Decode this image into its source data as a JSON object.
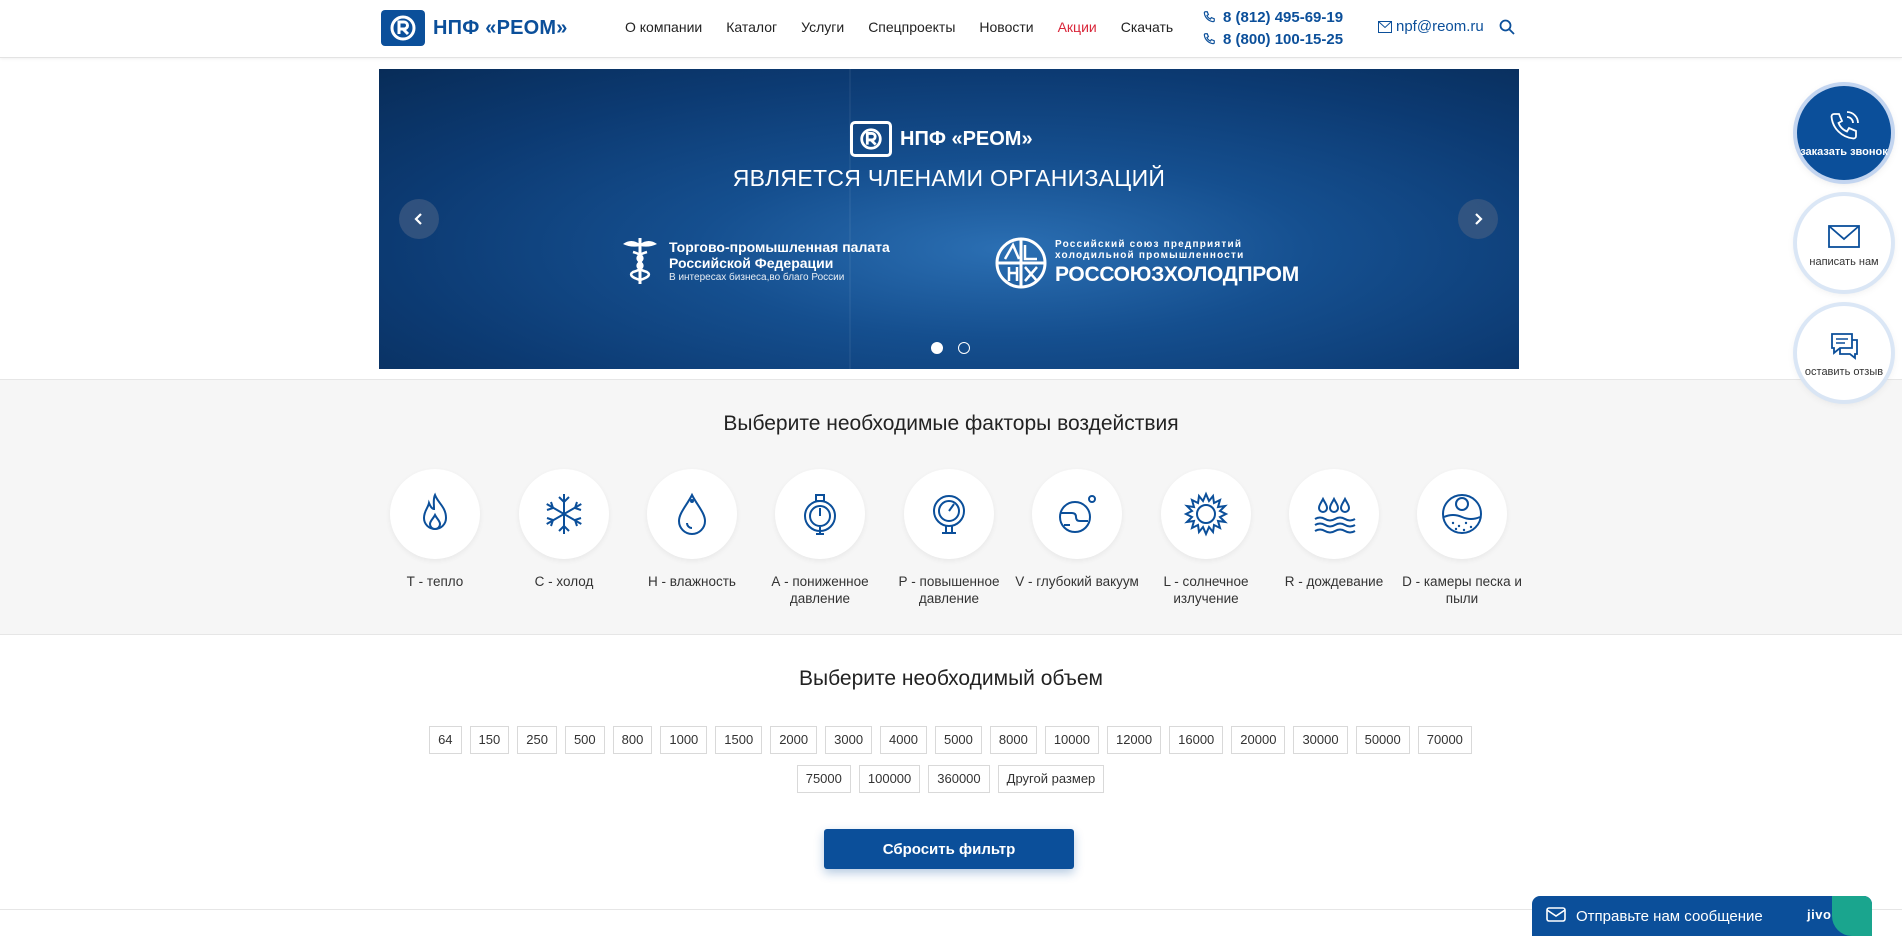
{
  "header": {
    "logo_text": "НПФ «РЕОМ»",
    "nav": [
      {
        "label": "О компании"
      },
      {
        "label": "Каталог"
      },
      {
        "label": "Услуги"
      },
      {
        "label": "Спецпроекты"
      },
      {
        "label": "Новости"
      },
      {
        "label": "Акции"
      },
      {
        "label": "Скачать"
      }
    ],
    "phones": [
      "8 (812) 495-69-19",
      "8 (800) 100-15-25"
    ],
    "email": "npf@reom.ru"
  },
  "slider": {
    "logo_text": "НПФ «РЕОМ»",
    "title": "ЯВЛЯЕТСЯ ЧЛЕНАМИ ОРГАНИЗАЦИЙ",
    "org1": {
      "line1": "Торгово-промышленная палата",
      "line2": "Российской Федерации",
      "line3": "В интересах бизнеса,во благо России"
    },
    "org2": {
      "line1": "Российский союз предприятий",
      "line2": "холодильной промышленности",
      "name": "РОССОЮЗХОЛОДПРОМ"
    },
    "active_slide": 1,
    "slide_count": 2
  },
  "factors": {
    "title": "Выберите необходимые факторы воздействия",
    "items": [
      {
        "label": "Т - тепло",
        "icon": "flame-icon"
      },
      {
        "label": "С - холод",
        "icon": "snowflake-icon"
      },
      {
        "label": "Н - влажность",
        "icon": "drop-icon"
      },
      {
        "label": "А - пониженное давление",
        "icon": "gauge-low-icon"
      },
      {
        "label": "Р - повышенное давление",
        "icon": "gauge-high-icon"
      },
      {
        "label": "V - глубокий вакуум",
        "icon": "vacuum-icon"
      },
      {
        "label": "L - солнечное излучение",
        "icon": "sun-icon"
      },
      {
        "label": "R - дождевание",
        "icon": "rain-icon"
      },
      {
        "label": "D - камеры песка и пыли",
        "icon": "dust-icon"
      }
    ]
  },
  "volume": {
    "title": "Выберите необходимый объем",
    "options": [
      "64",
      "150",
      "250",
      "500",
      "800",
      "1000",
      "1500",
      "2000",
      "3000",
      "4000",
      "5000",
      "8000",
      "10000",
      "12000",
      "16000",
      "20000",
      "30000",
      "50000",
      "70000",
      "75000",
      "100000",
      "360000",
      "Другой размер"
    ],
    "reset_label": "Сбросить фильтр"
  },
  "floating": {
    "call": "заказать звонок",
    "write": "написать нам",
    "review": "оставить отзыв"
  },
  "chat": {
    "label": "Отправьте нам сообщение",
    "brand": "jivo"
  },
  "colors": {
    "brand": "#0b4f9a",
    "promo": "#d9263a",
    "chat_accent": "#1aa58e"
  }
}
